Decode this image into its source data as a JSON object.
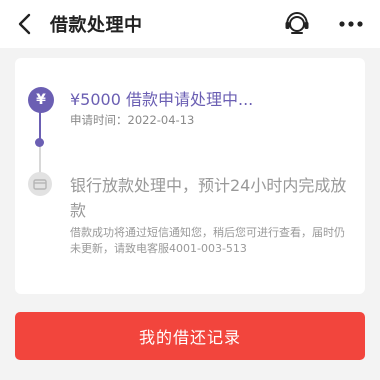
{
  "header": {
    "title": "借款处理中",
    "back_icon": "chevron-left-icon",
    "service_icon": "headset-icon",
    "more_icon": "more-dots-icon"
  },
  "steps": [
    {
      "title": "¥5000 借款申请处理中...",
      "time": "申请时间：2022-04-13",
      "icon": "yuan-icon",
      "icon_text": "¥",
      "status": "active"
    },
    {
      "title": "银行放款处理中，预计24小时内完成放款",
      "note": "借款成功将通过短信通知您，稍后您可进行查看，届时仍未更新，请致电客服4001-003-513",
      "icon": "bank-card-icon",
      "status": "pending"
    }
  ],
  "footer": {
    "button_label": "我的借还记录"
  },
  "colors": {
    "accent": "#6b5fb3",
    "button": "#f2453d",
    "background": "#f3f3f3"
  }
}
